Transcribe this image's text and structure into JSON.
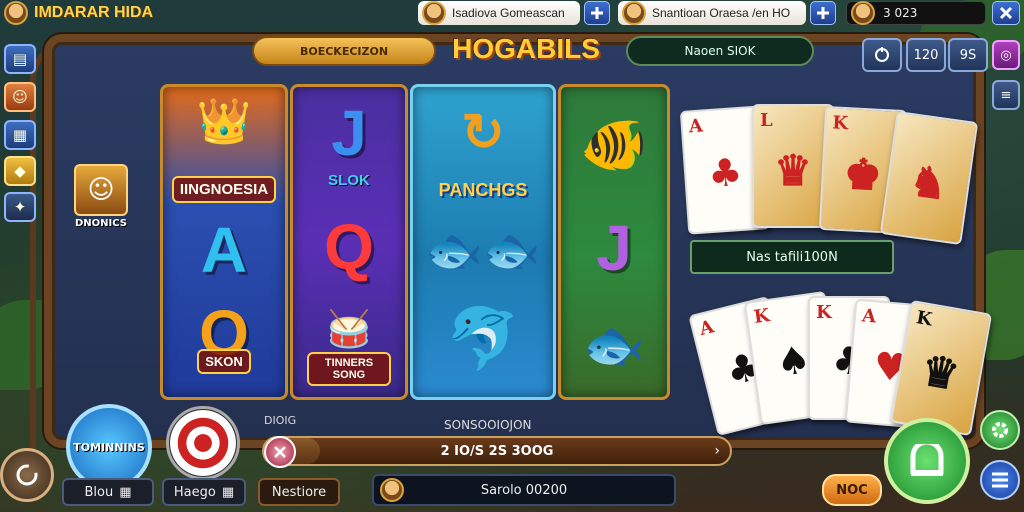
{
  "header": {
    "game_title": "IMDARAR HIDA",
    "player1_name": "Isadiova Gomeascan",
    "player2_name": "Snantioan Oraesa /en HO",
    "coins": "3  023"
  },
  "marquee": {
    "left_banner": "BOECKECIZON",
    "logo": "HOGABILS",
    "right_banner": "Naoen SIOK",
    "stats": [
      "120",
      "9S"
    ]
  },
  "left_badge": {
    "label": "DNONICS"
  },
  "reels": {
    "r1": {
      "banner": "IINGNOESIA",
      "mid": "A",
      "bottom_letter": "O",
      "bottom_label": "SKON"
    },
    "r2": {
      "top": "J",
      "top_label": "SLOK",
      "mid": "Q",
      "bottom_label": "TINNERS SONG"
    },
    "r3": {
      "top_label": "PANCHGS"
    },
    "r4": {
      "mid": "J"
    }
  },
  "cards": {
    "top": [
      {
        "rank": "A",
        "suit": "♣"
      },
      {
        "rank": "L",
        "suit": "♛"
      },
      {
        "rank": "K",
        "suit": "♚"
      },
      {
        "rank": "",
        "suit": "♞"
      }
    ],
    "banner": "Nas tafili100N",
    "bottom": [
      {
        "rank": "A",
        "suit": "♣"
      },
      {
        "rank": "K",
        "suit": "♠"
      },
      {
        "rank": "K",
        "suit": "♣"
      },
      {
        "rank": "A",
        "suit": "♥"
      },
      {
        "rank": "K",
        "suit": "♛"
      }
    ]
  },
  "bottom": {
    "left_round_label": "TOMINNINS",
    "left_box": "Blou",
    "center_box": "Haego",
    "third_box": "Nestiore",
    "left_small": "DIOIG",
    "progress_label": "SONSOOIOJON",
    "progress_text": "2 IO/S 2S 3OOG",
    "progress_fraction": 0.12,
    "balance_text": "Sarolo 00200",
    "action_button": "NOC"
  }
}
